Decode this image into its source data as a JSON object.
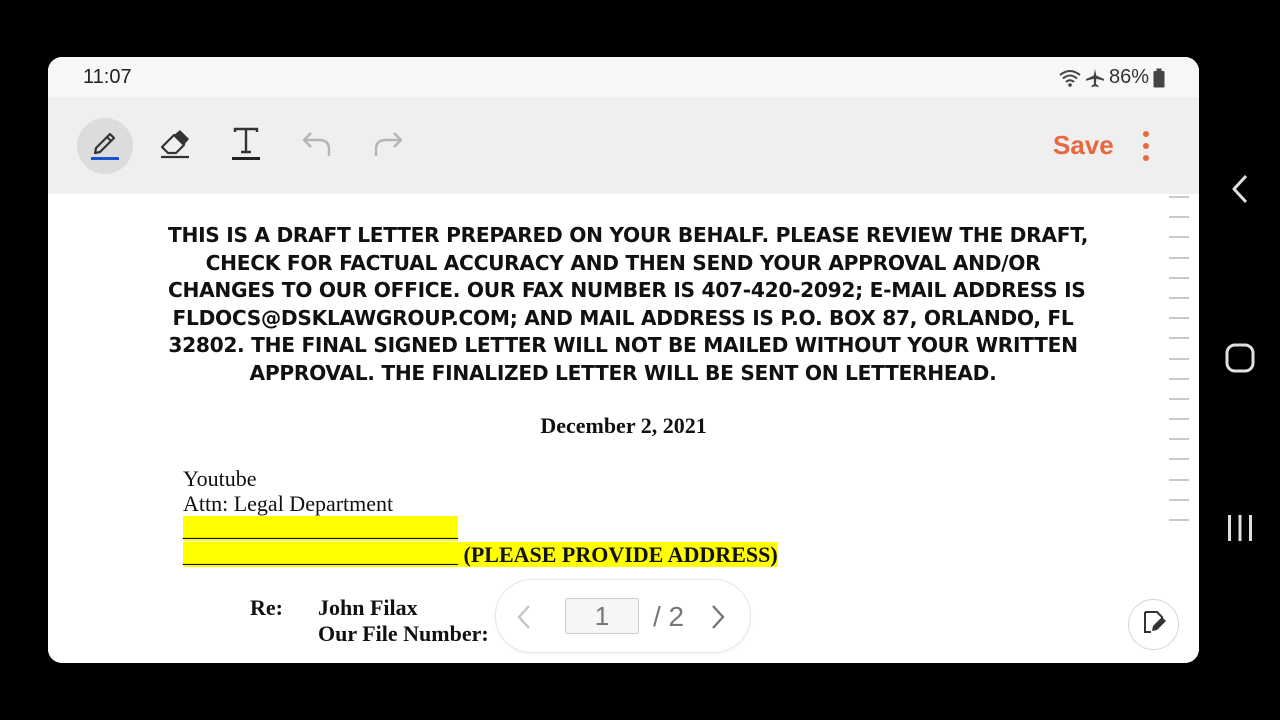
{
  "statusbar": {
    "time": "11:07",
    "battery": "86%",
    "icons": [
      "wifi-icon",
      "airplane-icon",
      "battery-icon"
    ]
  },
  "toolbar": {
    "tools": [
      "pen-icon",
      "eraser-icon",
      "text-icon",
      "undo-icon",
      "redo-icon"
    ],
    "save_label": "Save",
    "accent": "#e8673f",
    "pen_underline": "#1a4fd6"
  },
  "document": {
    "disclaimer_lines": [
      "THIS IS A DRAFT LETTER PREPARED ON YOUR BEHALF.  PLEASE REVIEW THE DRAFT,",
      "CHECK FOR FACTUAL ACCURACY AND THEN SEND YOUR APPROVAL AND/OR",
      "CHANGES TO OUR OFFICE.  OUR FAX NUMBER IS 407-420-2092; E-MAIL ADDRESS IS",
      "FLDOCS@DSKLAWGROUP.COM; AND MAIL ADDRESS IS P.O. BOX 87, ORLANDO, FL",
      "32802.  THE FINAL SIGNED LETTER WILL NOT BE MAILED WITHOUT YOUR WRITTEN",
      "APPROVAL.  THE FINALIZED LETTER WILL BE SENT ON LETTERHEAD."
    ],
    "date": "December 2, 2021",
    "recipient": "Youtube",
    "attn": "Attn: Legal Department",
    "blank_line": "_________________________",
    "address_prompt": " (PLEASE PROVIDE ADDRESS)",
    "highlight_color": "#ffff00",
    "re_label": "Re:",
    "re_name": "John Filax",
    "re_file": "Our File Number:"
  },
  "pager": {
    "current_page": "1",
    "total": "/ 2"
  },
  "nav": [
    "back-icon",
    "home-icon",
    "recents-icon"
  ]
}
